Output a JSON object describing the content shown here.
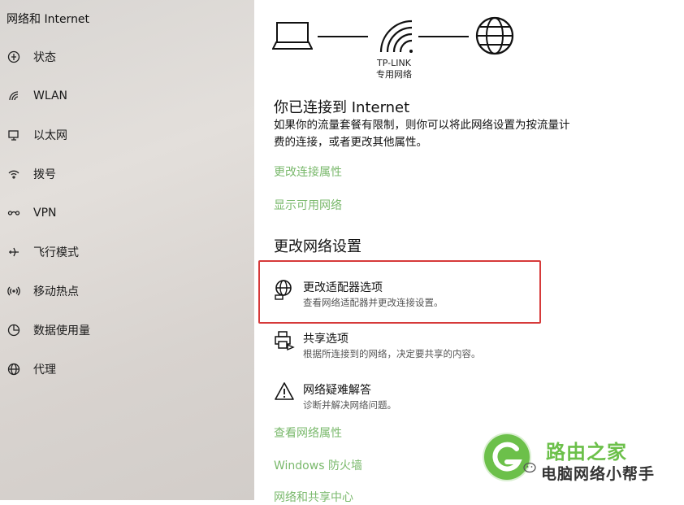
{
  "sidebar": {
    "title": "网络和 Internet",
    "items": [
      {
        "label": "状态",
        "icon": "home-icon"
      },
      {
        "label": "WLAN",
        "icon": "wifi-icon"
      },
      {
        "label": "以太网",
        "icon": "ethernet-icon"
      },
      {
        "label": "拨号",
        "icon": "dialup-icon"
      },
      {
        "label": "VPN",
        "icon": "vpn-icon"
      },
      {
        "label": "飞行模式",
        "icon": "airplane-icon"
      },
      {
        "label": "移动热点",
        "icon": "hotspot-icon"
      },
      {
        "label": "数据使用量",
        "icon": "data-usage-icon"
      },
      {
        "label": "代理",
        "icon": "globe-icon"
      }
    ]
  },
  "main": {
    "diagram": {
      "network_name": "TP-LINK",
      "network_type": "专用网络"
    },
    "status_heading": "你已连接到 Internet",
    "status_text_line1": "如果你的流量套餐有限制，则你可以将此网络设置为按流量计",
    "status_text_line2": "费的连接，或者更改其他属性。",
    "link_change_properties": "更改连接属性",
    "link_show_networks": "显示可用网络",
    "settings_heading": "更改网络设置",
    "options": [
      {
        "title": "更改适配器选项",
        "desc": "查看网络适配器并更改连接设置。",
        "icon": "adapter-globe-icon"
      },
      {
        "title": "共享选项",
        "desc": "根据所连接到的网络，决定要共享的内容。",
        "icon": "printer-share-icon"
      },
      {
        "title": "网络疑难解答",
        "desc": "诊断并解决网络问题。",
        "icon": "warning-icon"
      }
    ],
    "link_view_properties": "查看网络属性",
    "link_firewall": "Windows 防火墙",
    "link_sharing_center": "网络和共享中心"
  },
  "watermark": {
    "brand": "路由之家",
    "account": "电脑网络小帮手"
  },
  "colors": {
    "link": "#7ab96c",
    "highlight": "#d63a3a",
    "watermark_green": "#6cc04a"
  }
}
